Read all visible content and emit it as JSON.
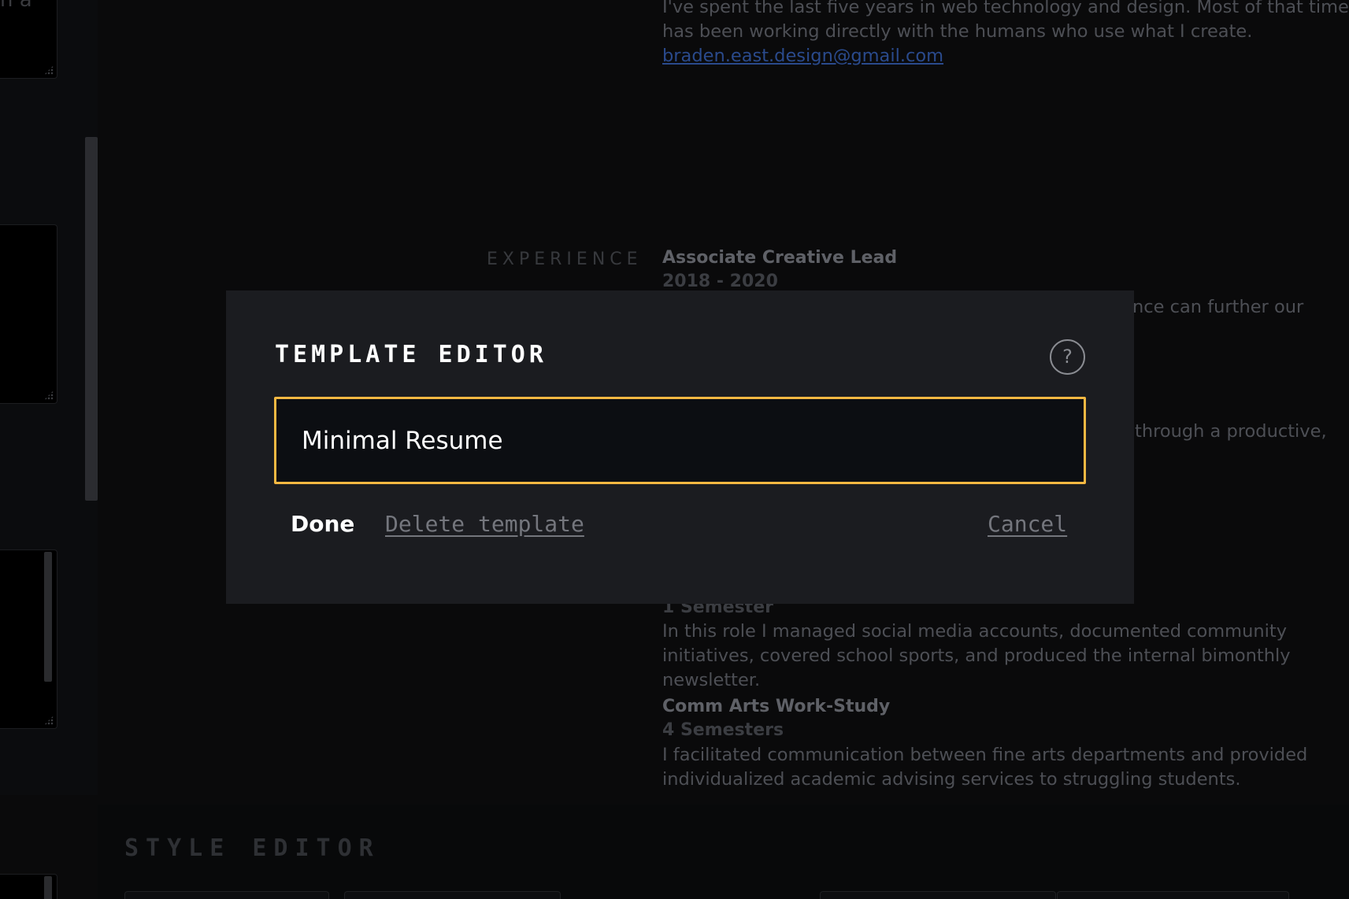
{
  "sidebar": {
    "cards": [
      {
        "text": "n a"
      },
      {
        "text": ""
      },
      {
        "text": ""
      }
    ]
  },
  "background": {
    "intro": {
      "paragraph": "I've spent the last five years in web technology and design. Most of that time has been working directly with the humans who use what I create.",
      "email": "braden.east.design@gmail.com"
    },
    "section_label": "EXPERIENCE",
    "jobs": [
      {
        "title": "Associate Creative Lead",
        "dates": "2018 - 2020",
        "partial_lines": [
          "nce can further our",
          "through a productive,"
        ]
      },
      {
        "dates": "1 Semester",
        "description": "In this role I managed social media accounts, documented community initiatives, covered school sports, and produced the internal bimonthly newsletter."
      },
      {
        "title": "Comm Arts Work-Study",
        "dates": "4 Semesters",
        "description": "I facilitated communication between fine arts departments and provided individualized academic advising services to struggling students."
      }
    ],
    "style_editor_title": "STYLE EDITOR"
  },
  "modal": {
    "title": "TEMPLATE EDITOR",
    "help_label": "?",
    "template_name": "Minimal Resume",
    "done_label": "Done",
    "delete_label": "Delete template",
    "cancel_label": "Cancel"
  },
  "colors": {
    "accent": "#f5b842",
    "modal_bg": "#1b1c20",
    "input_bg": "#0c0e12"
  }
}
